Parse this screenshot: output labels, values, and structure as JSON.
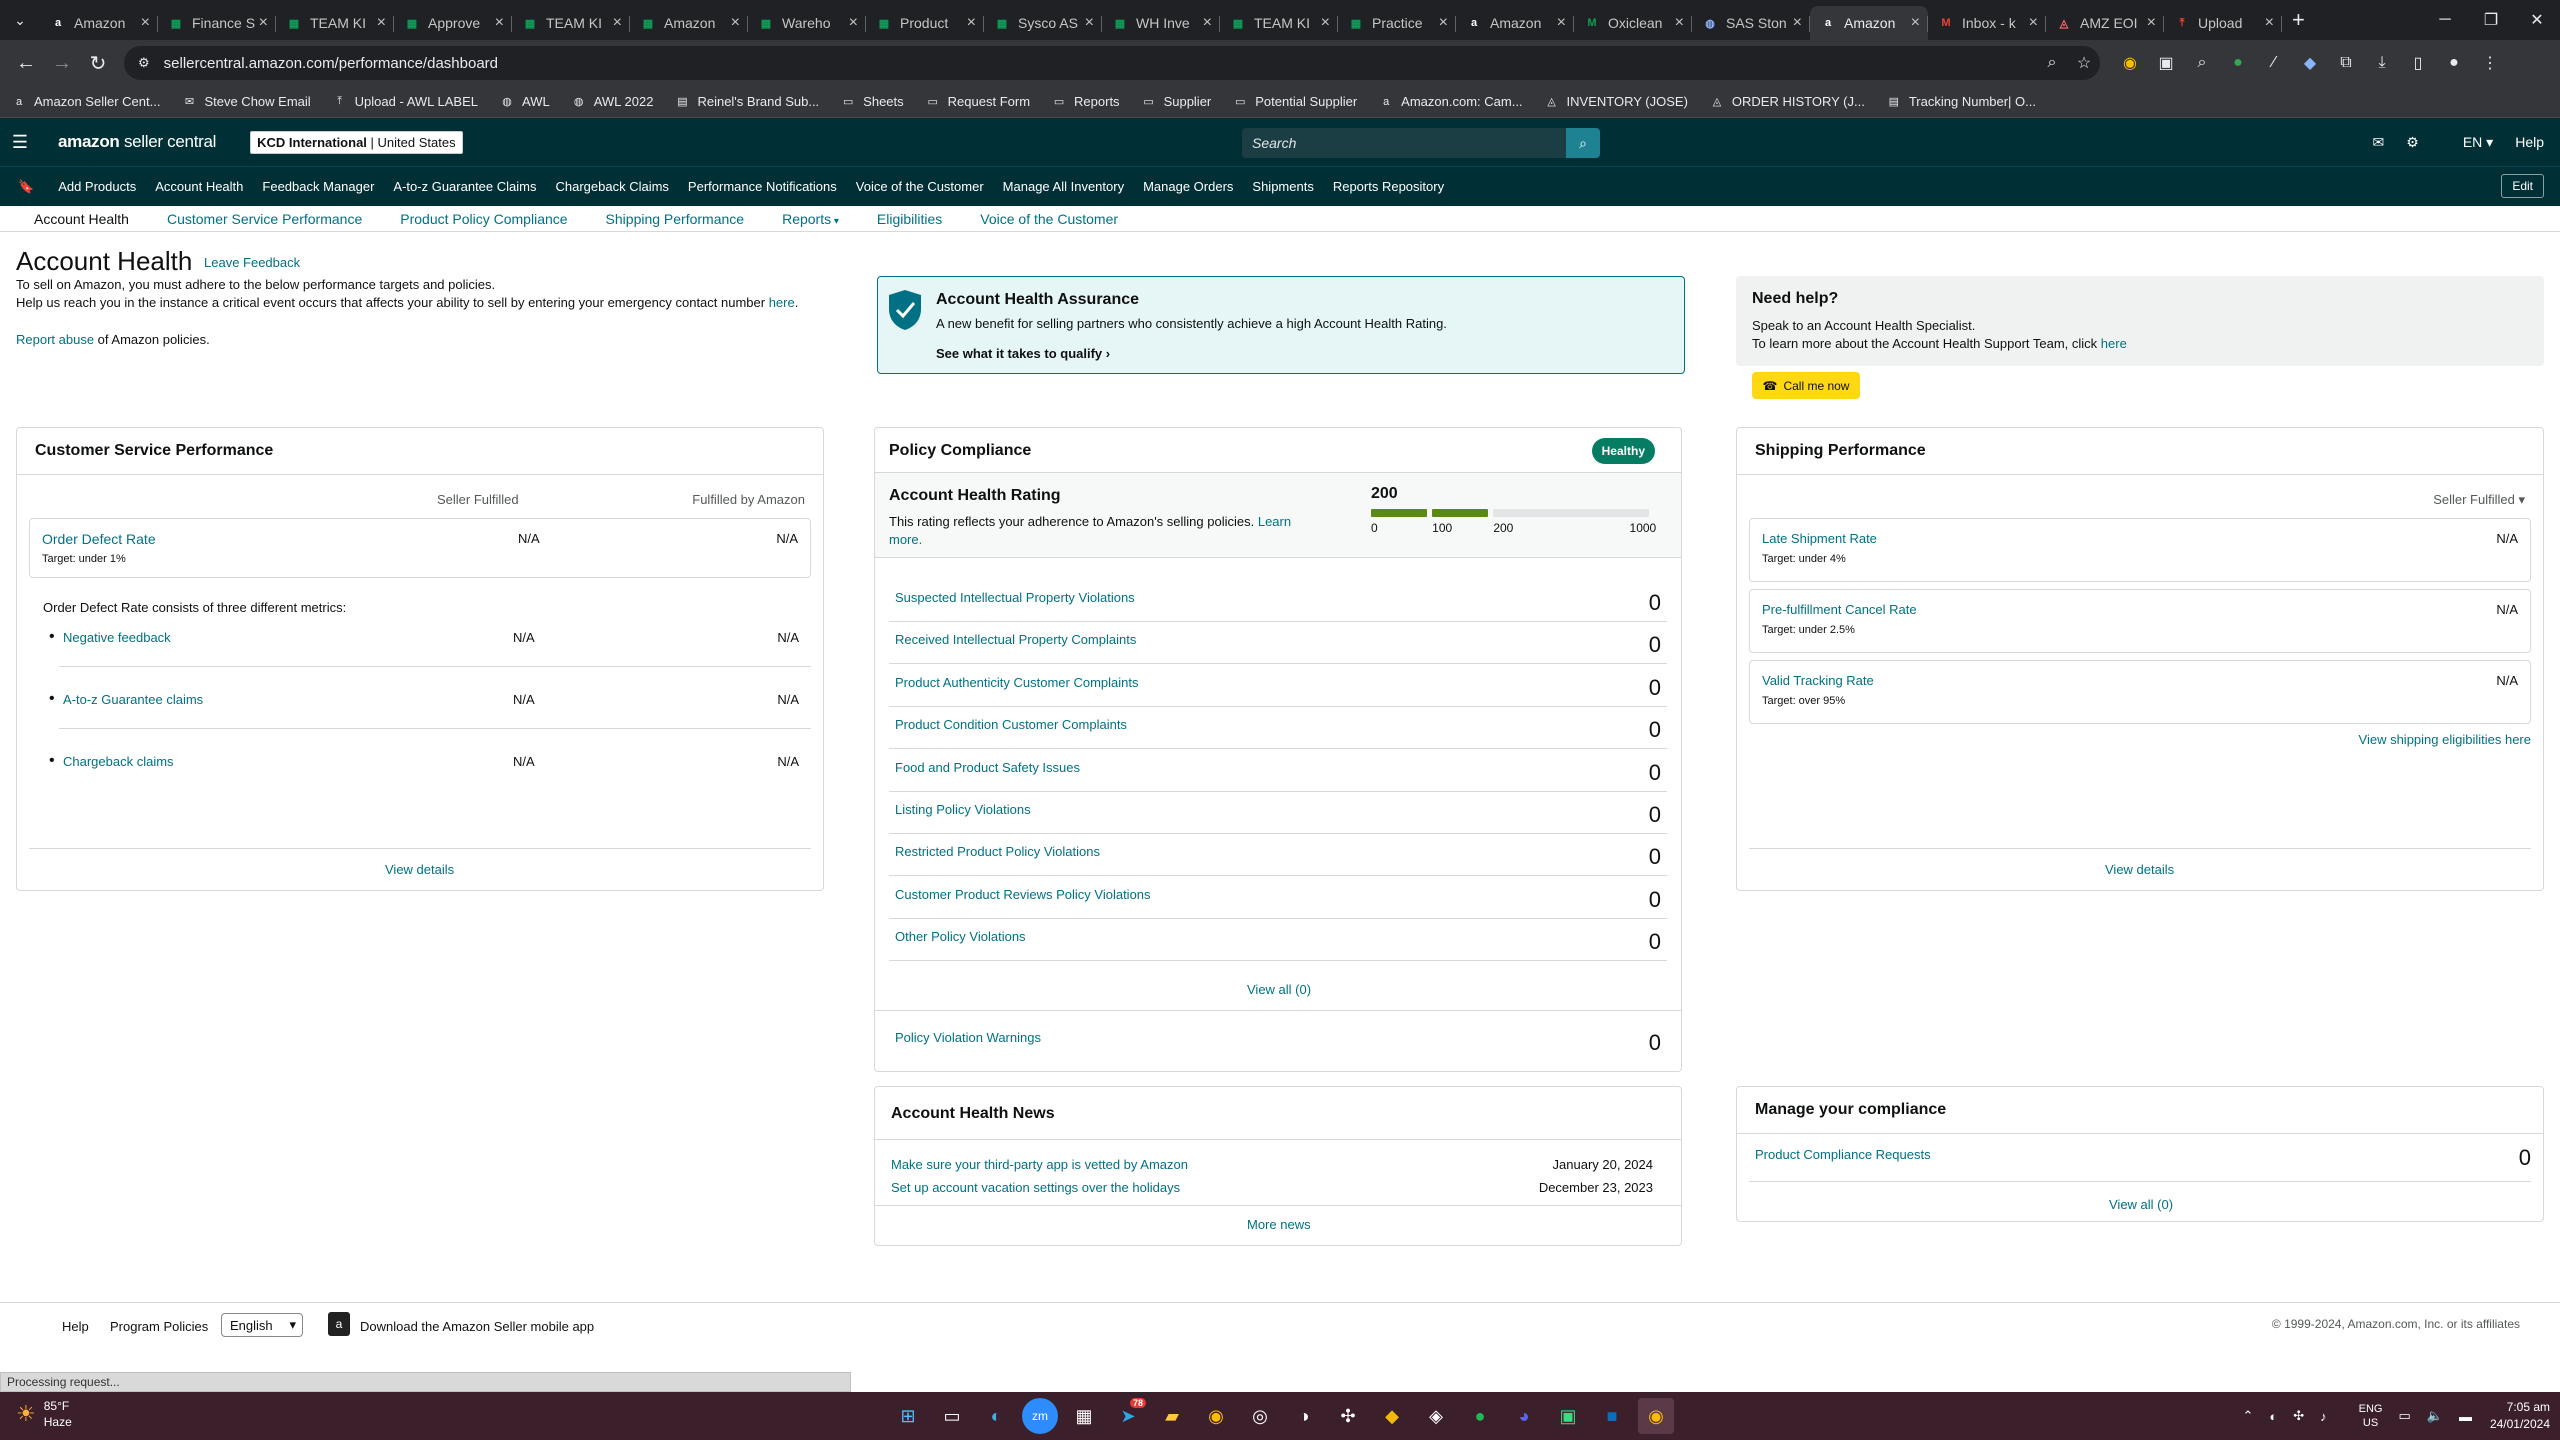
{
  "browser": {
    "tabs": [
      {
        "label": "Amazon",
        "icon": "amazon-icon",
        "color": "#ffffff"
      },
      {
        "label": "Finance S",
        "icon": "sheets-icon",
        "color": "#0f9d58"
      },
      {
        "label": "TEAM KI",
        "icon": "sheets-icon",
        "color": "#0f9d58"
      },
      {
        "label": "Approve",
        "icon": "sheets-icon",
        "color": "#0f9d58"
      },
      {
        "label": "TEAM KI",
        "icon": "sheets-icon",
        "color": "#0f9d58"
      },
      {
        "label": "Amazon",
        "icon": "sheets-icon",
        "color": "#0f9d58"
      },
      {
        "label": "Wareho",
        "icon": "sheets-icon",
        "color": "#0f9d58"
      },
      {
        "label": "Product",
        "icon": "sheets-icon",
        "color": "#0f9d58"
      },
      {
        "label": "Sysco AS",
        "icon": "sheets-icon",
        "color": "#0f9d58"
      },
      {
        "label": "WH Inve",
        "icon": "sheets-icon",
        "color": "#0f9d58"
      },
      {
        "label": "TEAM KI",
        "icon": "sheets-icon",
        "color": "#0f9d58"
      },
      {
        "label": "Practice",
        "icon": "sheets-icon",
        "color": "#0f9d58"
      },
      {
        "label": "Amazon",
        "icon": "amazon-icon",
        "color": "#ffffff"
      },
      {
        "label": "Oxiclean",
        "icon": "gmail-icon",
        "color": "#0f9d58"
      },
      {
        "label": "SAS Ston",
        "icon": "globe-icon",
        "color": "#8ab4f8"
      },
      {
        "label": "Amazon",
        "icon": "amazon-icon",
        "color": "#ffffff",
        "active": true
      },
      {
        "label": "Inbox - k",
        "icon": "gmail-icon",
        "color": "#ea4335"
      },
      {
        "label": "AMZ EOI",
        "icon": "clickup-icon",
        "color": "#ff6b6b"
      },
      {
        "label": "Upload",
        "icon": "upload-icon",
        "color": "#ea4335"
      }
    ],
    "url": "sellercentral.amazon.com/performance/dashboard",
    "bookmarks": [
      {
        "label": "Amazon Seller Cent...",
        "icon": "amazon-icon"
      },
      {
        "label": "Steve Chow Email",
        "icon": "mail-icon"
      },
      {
        "label": "Upload - AWL LABEL",
        "icon": "upload-icon"
      },
      {
        "label": "AWL",
        "icon": "globe-icon"
      },
      {
        "label": "AWL 2022",
        "icon": "globe-icon"
      },
      {
        "label": "Reinel's Brand Sub...",
        "icon": "page-icon"
      },
      {
        "label": "Sheets",
        "icon": "folder-icon"
      },
      {
        "label": "Request Form",
        "icon": "folder-icon"
      },
      {
        "label": "Reports",
        "icon": "folder-icon"
      },
      {
        "label": "Supplier",
        "icon": "folder-icon"
      },
      {
        "label": "Potential Supplier",
        "icon": "folder-icon"
      },
      {
        "label": "Amazon.com: Cam...",
        "icon": "amazon-icon"
      },
      {
        "label": "INVENTORY (JOSE)",
        "icon": "clickup-icon"
      },
      {
        "label": "ORDER HISTORY (J...",
        "icon": "clickup-icon"
      },
      {
        "label": "Tracking Number| O...",
        "icon": "page-icon"
      }
    ]
  },
  "header": {
    "logo_main": "amazon",
    "logo_sub": "seller central",
    "account_bold": "KCD International",
    "account_rest": " | United States",
    "search_placeholder": "Search",
    "lang": "EN",
    "help": "Help"
  },
  "nav": {
    "items": [
      "Add Products",
      "Account Health",
      "Feedback Manager",
      "A-to-z Guarantee Claims",
      "Chargeback Claims",
      "Performance Notifications",
      "Voice of the Customer",
      "Manage All Inventory",
      "Manage Orders",
      "Shipments",
      "Reports Repository"
    ],
    "edit": "Edit"
  },
  "subnav": [
    "Account Health",
    "Customer Service Performance",
    "Product Policy Compliance",
    "Shipping Performance",
    "Reports",
    "Eligibilities",
    "Voice of the Customer"
  ],
  "page": {
    "title": "Account Health",
    "leave_feedback": "Leave Feedback",
    "intro1": "To sell on Amazon, you must adhere to the below performance targets and policies.",
    "intro2": "Help us reach you in the instance a critical event occurs that affects your ability to sell by entering your emergency contact number ",
    "intro2_link": "here",
    "report_abuse": "Report abuse",
    "report_abuse_rest": " of Amazon policies."
  },
  "aha": {
    "title": "Account Health Assurance",
    "desc": "A new benefit for selling partners who consistently achieve a high Account Health Rating.",
    "qualify": "See what it takes to qualify"
  },
  "help": {
    "title": "Need help?",
    "line1": "Speak to an Account Health Specialist.",
    "line2": "To learn more about the Account Health Support Team, click ",
    "line2_link": "here",
    "call": "Call me now"
  },
  "csp": {
    "title": "Customer Service Performance",
    "col1": "Seller Fulfilled",
    "col2": "Fulfilled by Amazon",
    "odr_label": "Order Defect Rate",
    "odr_target": "Target: under 1%",
    "odr_sf": "N/A",
    "odr_fba": "N/A",
    "consists": "Order Defect Rate consists of three different metrics:",
    "metrics": [
      {
        "label": "Negative feedback",
        "sf": "N/A",
        "fba": "N/A"
      },
      {
        "label": "A-to-z Guarantee claims",
        "sf": "N/A",
        "fba": "N/A"
      },
      {
        "label": "Chargeback claims",
        "sf": "N/A",
        "fba": "N/A"
      }
    ],
    "view": "View details"
  },
  "policy": {
    "title": "Policy Compliance",
    "status": "Healthy",
    "ahr_title": "Account Health Rating",
    "ahr_desc": "This rating reflects your adherence to Amazon's selling policies. ",
    "ahr_link": "Learn more.",
    "ahr_value": "200",
    "ahr_fraction": 0.2,
    "scale": [
      "0",
      "100",
      "200",
      "1000"
    ],
    "rows": [
      {
        "label": "Suspected Intellectual Property Violations",
        "value": "0"
      },
      {
        "label": "Received Intellectual Property Complaints",
        "value": "0"
      },
      {
        "label": "Product Authenticity Customer Complaints",
        "value": "0"
      },
      {
        "label": "Product Condition Customer Complaints",
        "value": "0"
      },
      {
        "label": "Food and Product Safety Issues",
        "value": "0"
      },
      {
        "label": "Listing Policy Violations",
        "value": "0"
      },
      {
        "label": "Restricted Product Policy Violations",
        "value": "0"
      },
      {
        "label": "Customer Product Reviews Policy Violations",
        "value": "0"
      },
      {
        "label": "Other Policy Violations",
        "value": "0"
      }
    ],
    "view_all": "View all (0)",
    "warnings_label": "Policy Violation Warnings",
    "warnings_value": "0"
  },
  "news": {
    "title": "Account Health News",
    "items": [
      {
        "label": "Make sure your third-party app is vetted by Amazon",
        "date": "January 20, 2024"
      },
      {
        "label": "Set up account vacation settings over the holidays",
        "date": "December 23, 2023"
      }
    ],
    "more": "More news"
  },
  "shipping": {
    "title": "Shipping Performance",
    "filter": "Seller Fulfilled",
    "rows": [
      {
        "label": "Late Shipment Rate",
        "target": "Target: under 4%",
        "value": "N/A"
      },
      {
        "label": "Pre-fulfillment Cancel Rate",
        "target": "Target: under 2.5%",
        "value": "N/A"
      },
      {
        "label": "Valid Tracking Rate",
        "target": "Target: over 95%",
        "value": "N/A"
      }
    ],
    "eligibilities": "View shipping eligibilities here",
    "view": "View details"
  },
  "compliance": {
    "title": "Manage your compliance",
    "row_label": "Product Compliance Requests",
    "row_value": "0",
    "view_all": "View all (0)"
  },
  "footer": {
    "help": "Help",
    "policies": "Program Policies",
    "lang": "English",
    "app": "Download the Amazon Seller mobile app",
    "copyright": "© 1999-2024, Amazon.com, Inc. or its affiliates"
  },
  "status_bar": "Processing request...",
  "taskbar": {
    "temp": "85°F",
    "cond": "Haze",
    "lang1": "ENG",
    "lang2": "US",
    "time": "7:05 am",
    "date": "24/01/2024",
    "badge_telegram": "78"
  }
}
